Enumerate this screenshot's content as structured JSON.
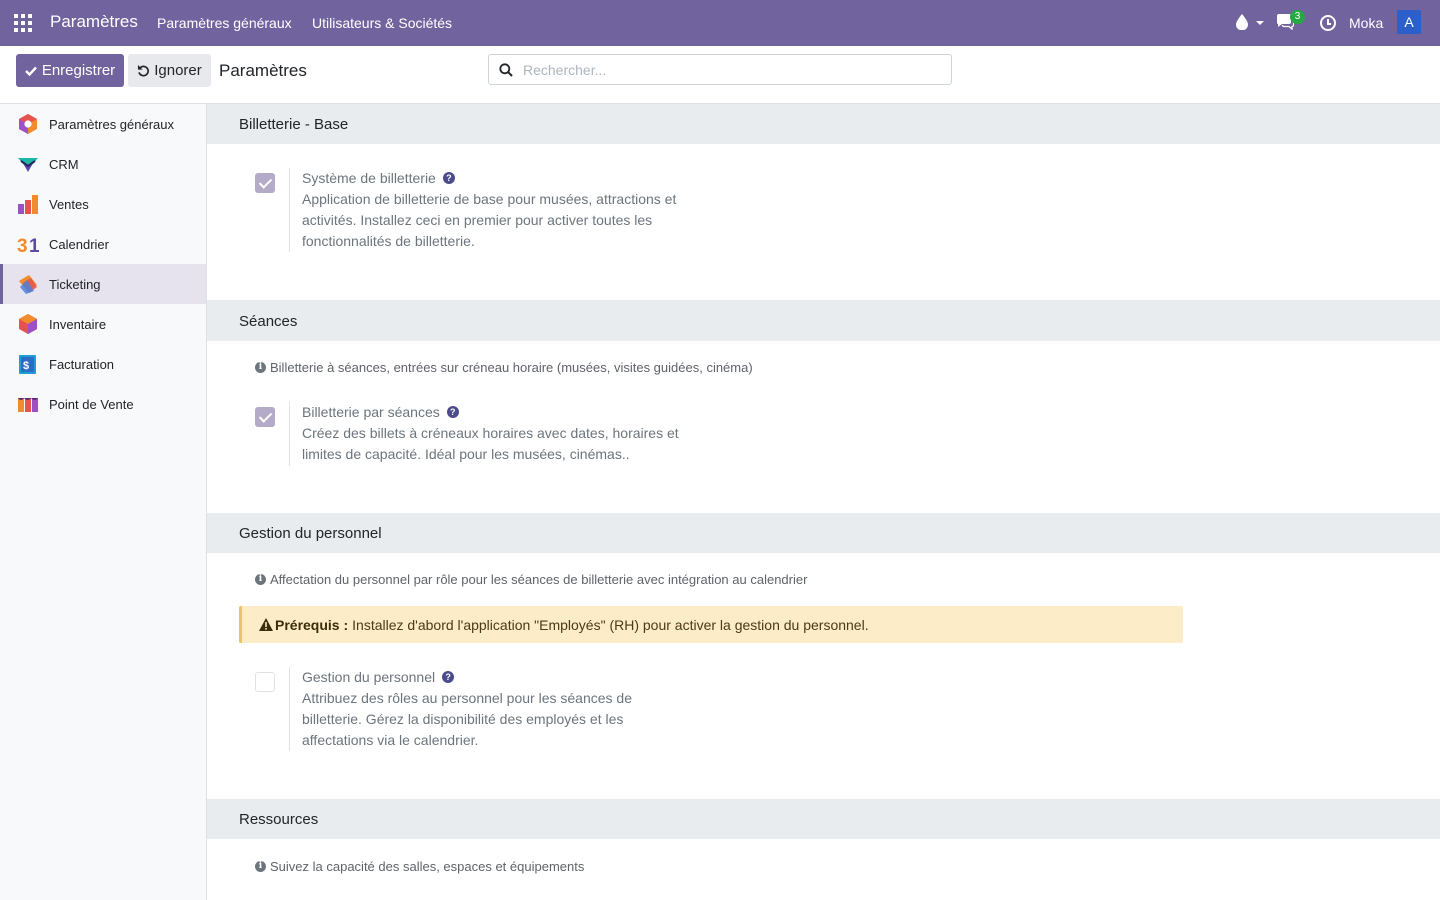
{
  "navbar": {
    "brand": "Paramètres",
    "menu": [
      "Paramètres généraux",
      "Utilisateurs & Sociétés"
    ],
    "chat_count": "3",
    "company": "Moka",
    "avatar_initial": "A",
    "color": "#71639e"
  },
  "control": {
    "save_label": "Enregistrer",
    "discard_label": "Ignorer",
    "title": "Paramètres",
    "search_placeholder": "Rechercher..."
  },
  "sidebar": {
    "items": [
      {
        "label": "Paramètres généraux",
        "icon": "settings-app-icon"
      },
      {
        "label": "CRM",
        "icon": "crm-app-icon"
      },
      {
        "label": "Ventes",
        "icon": "sales-app-icon"
      },
      {
        "label": "Calendrier",
        "icon": "calendar-app-icon"
      },
      {
        "label": "Ticketing",
        "icon": "ticketing-app-icon",
        "active": true
      },
      {
        "label": "Inventaire",
        "icon": "inventory-app-icon"
      },
      {
        "label": "Facturation",
        "icon": "invoicing-app-icon"
      },
      {
        "label": "Point de Vente",
        "icon": "pos-app-icon"
      }
    ]
  },
  "sections": [
    {
      "title": "Billetterie - Base",
      "setting": {
        "title": "Système de billetterie",
        "checked": true,
        "desc": "Application de billetterie de base pour musées, attractions et activités. Installez ceci en premier pour activer toutes les fonctionnalités de billetterie."
      }
    },
    {
      "title": "Séances",
      "info": "Billetterie à séances, entrées sur créneau horaire (musées, visites guidées, cinéma)",
      "setting": {
        "title": "Billetterie par séances",
        "checked": true,
        "desc": "Créez des billets à créneaux horaires avec dates, horaires et limites de capacité. Idéal pour les musées, cinémas.."
      }
    },
    {
      "title": "Gestion du personnel",
      "info": "Affectation du personnel par rôle pour les séances de billetterie avec intégration au calendrier",
      "warning_label": "Prérequis :",
      "warning_text": "Installez d'abord l'application \"Employés\" (RH) pour activer la gestion du personnel.",
      "setting": {
        "title": "Gestion du personnel",
        "checked": false,
        "desc": "Attribuez des rôles au personnel pour les séances de billetterie. Gérez la disponibilité des employés et les affectations via le calendrier."
      }
    },
    {
      "title": "Ressources",
      "info": "Suivez la capacité des salles, espaces et équipements"
    }
  ]
}
